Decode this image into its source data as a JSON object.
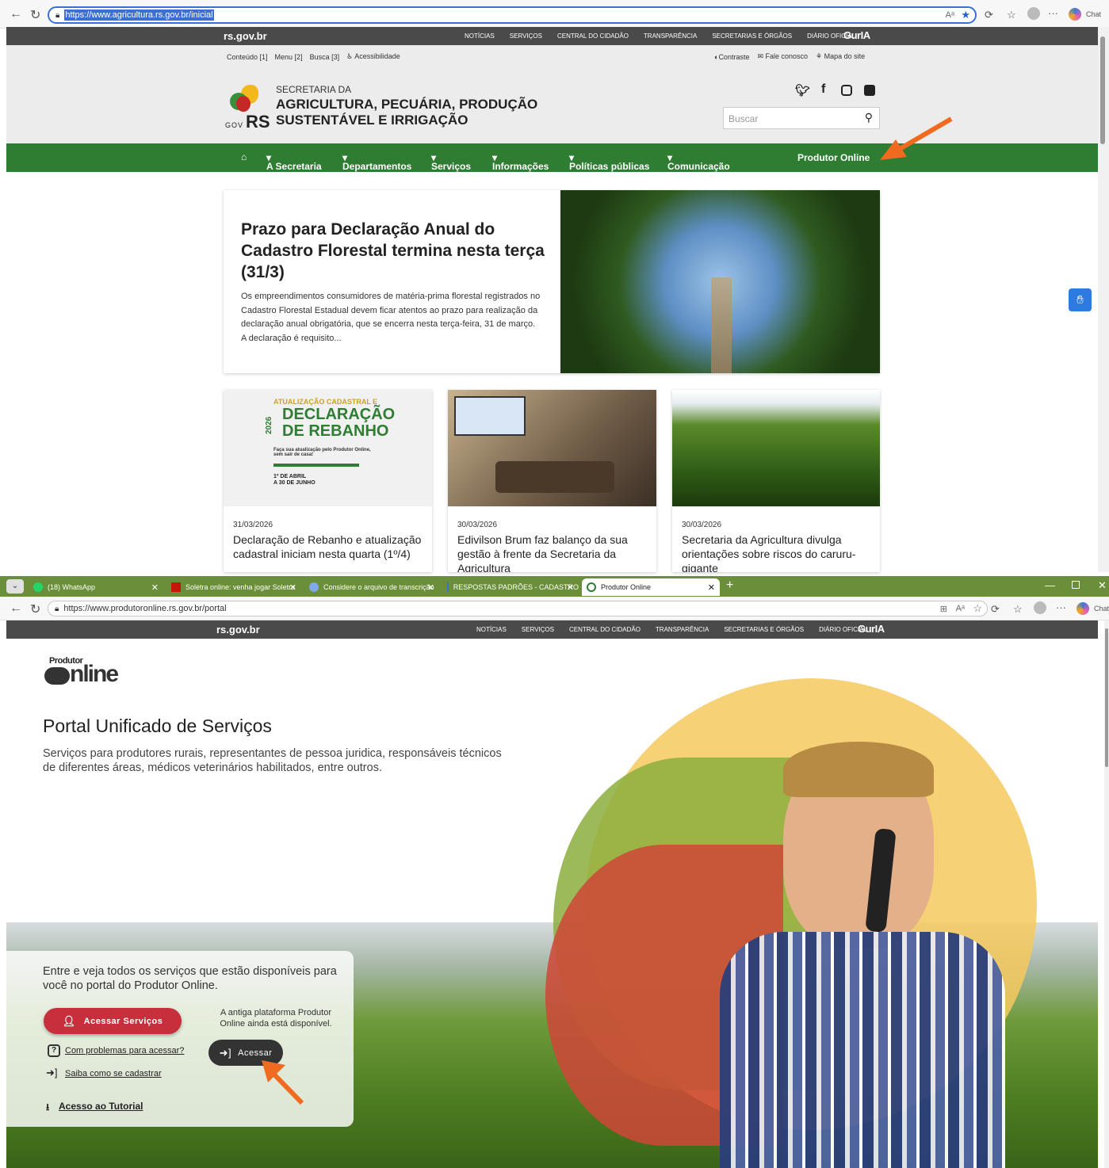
{
  "browser1": {
    "url_selected": "https://www.agricultura.rs.gov.br/inicial",
    "chat_label": "Chat"
  },
  "govbar": {
    "brand": "rs.gov.br",
    "links": [
      "NOTÍCIAS",
      "SERVIÇOS",
      "CENTRAL DO CIDADÃO",
      "TRANSPARÊNCIA",
      "SECRETARIAS E ÓRGÃOS",
      "DIÁRIO OFICIAL"
    ],
    "guria": "GurIA"
  },
  "accessibility": {
    "left": [
      "Conteúdo [1]",
      "Menu [2]",
      "Busca [3]",
      "Acessibilidade"
    ],
    "contrast": "Contraste",
    "contact": "Fale conosco",
    "sitemap": "Mapa do site"
  },
  "header": {
    "line1": "SECRETARIA DA",
    "line2": "AGRICULTURA, PECUÁRIA, PRODUÇÃO",
    "line3": "SUSTENTÁVEL E IRRIGAÇÃO",
    "gov": "GOV",
    "rs": "RS",
    "search_placeholder": "Buscar"
  },
  "mainnav": {
    "items": [
      "A Secretaria",
      "Departamentos",
      "Serviços",
      "Informações",
      "Políticas públicas",
      "Comunicação"
    ],
    "produtor": "Produtor Online"
  },
  "featured": {
    "title": "Prazo para Declaração Anual do Cadastro Florestal termina nesta terça (31/3)",
    "summary": "Os empreendimentos consumidores de matéria-prima florestal registrados no Cadastro Florestal Estadual devem ficar atentos ao prazo para realização da declaração anual obrigatória, que se encerra nesta terça-feira, 31 de março. A declaração é requisito..."
  },
  "news": [
    {
      "date": "31/03/2026",
      "title": "Declaração de Rebanho e atualização cadastral iniciam nesta quarta (1º/4)"
    },
    {
      "date": "30/03/2026",
      "title": "Edivilson Brum faz balanço da sua gestão à frente da Secretaria da Agricultura"
    },
    {
      "date": "30/03/2026",
      "title": "Secretaria da Agricultura divulga orientações sobre riscos do caruru-gigante"
    }
  ],
  "rebanho_card": {
    "top": "ATUALIZAÇÃO CADASTRAL E",
    "year": "2026",
    "big1": "DECLARAÇÃO",
    "big2": "DE REBANHO",
    "sub": "Faça sua atualização pelo Produtor Online, sem sair de casa!",
    "period1": "1º DE ABRIL",
    "period2": "A 30 DE JUNHO"
  },
  "tabs": [
    {
      "label": "(18) WhatsApp",
      "badge": "18"
    },
    {
      "label": "Soletra online: venha jogar Soletra"
    },
    {
      "label": "Considere o arquivo de transcrição"
    },
    {
      "label": "RESPOSTAS PADRÕES - CADASTRO"
    },
    {
      "label": "Produtor Online"
    }
  ],
  "browser2": {
    "url": "https://www.produtoronline.rs.gov.br/portal",
    "chat_label": "Chat"
  },
  "portal": {
    "logo_top": "Produtor",
    "logo_main": "nline",
    "title": "Portal Unificado de Serviços",
    "description": "Serviços para produtores rurais, representantes de pessoa juridica, responsáveis técnicos de diferentes áreas, médicos veterinários habilitados, entre outros.",
    "panel_text": "Entre e veja todos os serviços que estão disponíveis para você no portal do Produtor Online.",
    "access_services": "Acessar Serviços",
    "old_platform": "A antiga plataforma Produtor Online ainda está disponível.",
    "access": "Acessar",
    "problems": "Com problemas para acessar?",
    "how_register": "Saiba como se cadastrar",
    "tutorial": "Acesso ao Tutorial"
  },
  "colors": {
    "gov_green": "#2e7d32",
    "portal_red": "#c62f3b",
    "arrow_orange": "#f06a1f"
  }
}
